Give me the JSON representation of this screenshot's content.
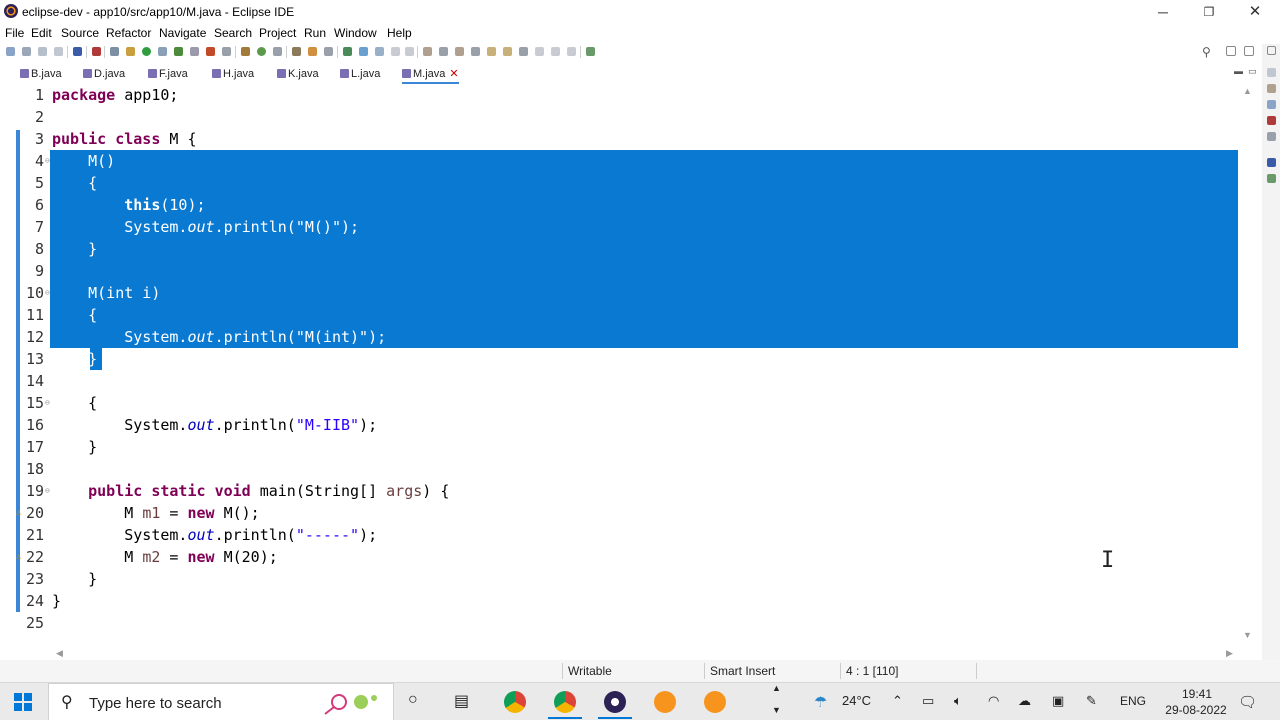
{
  "window": {
    "title": "eclipse-dev - app10/src/app10/M.java - Eclipse IDE",
    "minimize": "─",
    "restore": "❐",
    "close": "✕"
  },
  "menu": [
    "File",
    "Edit",
    "Source",
    "Refactor",
    "Navigate",
    "Search",
    "Project",
    "Run",
    "Window",
    "Help"
  ],
  "tabs": [
    {
      "label": "B.java",
      "active": false
    },
    {
      "label": "D.java",
      "active": false
    },
    {
      "label": "F.java",
      "active": false
    },
    {
      "label": "H.java",
      "active": false
    },
    {
      "label": "K.java",
      "active": false
    },
    {
      "label": "L.java",
      "active": false
    },
    {
      "label": "M.java",
      "active": true
    }
  ],
  "tab_close": "✕",
  "editor": {
    "lines": [
      {
        "num": "1"
      },
      {
        "num": "2"
      },
      {
        "num": "3"
      },
      {
        "num": "4"
      },
      {
        "num": "5"
      },
      {
        "num": "6"
      },
      {
        "num": "7"
      },
      {
        "num": "8"
      },
      {
        "num": "9"
      },
      {
        "num": "10"
      },
      {
        "num": "11"
      },
      {
        "num": "12"
      },
      {
        "num": "13"
      },
      {
        "num": "14"
      },
      {
        "num": "15"
      },
      {
        "num": "16"
      },
      {
        "num": "17"
      },
      {
        "num": "18"
      },
      {
        "num": "19"
      },
      {
        "num": "20"
      },
      {
        "num": "21"
      },
      {
        "num": "22"
      },
      {
        "num": "23"
      },
      {
        "num": "24"
      },
      {
        "num": "25"
      }
    ],
    "tokens": {
      "l1_kw": "package",
      "l1_rest": " app10;",
      "l3_kw1": "public",
      "l3_kw2": "class",
      "l3_rest": " M {",
      "l4": "    M()",
      "l5": "    {",
      "l6_kw": "this",
      "l6_rest": "(10);",
      "l7_a": "System.",
      "l7_fld": "out",
      "l7_b": ".println(",
      "l7_str": "\"M()\"",
      "l7_c": ");",
      "l8": "    }",
      "l10": "    M(int i)",
      "l11": "    {",
      "l12_a": "System.",
      "l12_fld": "out",
      "l12_b": ".println(",
      "l12_str": "\"M(int)\"",
      "l12_c": ");",
      "l13": "}",
      "l15": "    {",
      "l16_a": "System.",
      "l16_fld": "out",
      "l16_b": ".println(",
      "l16_str": "\"M-IIB\"",
      "l16_c": ");",
      "l17": "    }",
      "l19_kw1": "public",
      "l19_kw2": "static",
      "l19_kw3": "void",
      "l19_a": " main(String[] ",
      "l19_var": "args",
      "l19_b": ") {",
      "l20_a": "M ",
      "l20_var": "m1",
      "l20_b": " = ",
      "l20_kw": "new",
      "l20_c": " M();",
      "l21_a": "System.",
      "l21_fld": "out",
      "l21_b": ".println(",
      "l21_str": "\"-----\"",
      "l21_c": ");",
      "l22_a": "M ",
      "l22_var": "m2",
      "l22_b": " = ",
      "l22_kw": "new",
      "l22_c": " M(20);",
      "l23": "    }",
      "l24": "}"
    }
  },
  "status": {
    "writable": "Writable",
    "insert_mode": "Smart Insert",
    "position": "4 : 1 [110]"
  },
  "taskbar": {
    "search_placeholder": "Type here to search",
    "weather": "24°C",
    "language": "ENG",
    "time": "19:41",
    "date": "29-08-2022"
  },
  "colors": {
    "selection": "#0a79d1",
    "keyword": "#7f0055",
    "string": "#2a00ff",
    "field": "#0000c0"
  },
  "icons": [
    "eclipse-logo-icon",
    "search-icon",
    "java-file-icon",
    "close-icon",
    "windows-start-icon",
    "chrome-icon",
    "eclipse-icon",
    "text-cursor-icon"
  ]
}
